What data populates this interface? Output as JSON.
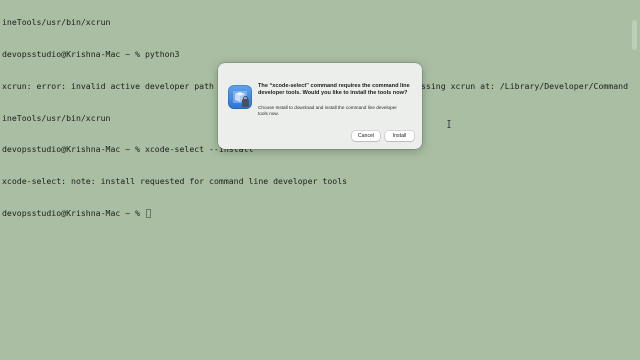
{
  "terminal": {
    "lines": [
      "ineTools/usr/bin/xcrun",
      "devopsstudio@Krishna-Mac ~ % python3",
      "xcrun: error: invalid active developer path (/Library/Developer/CommandLineTools), missing xcrun at: /Library/Developer/CommandL",
      "ineTools/usr/bin/xcrun",
      "devopsstudio@Krishna-Mac ~ % xcode-select --install",
      "xcode-select: note: install requested for command line developer tools",
      "devopsstudio@Krishna-Mac ~ % "
    ]
  },
  "dialog": {
    "title": "The “xcode-select” command requires the command line developer tools. Would you like to install the tools now?",
    "message": "Choose Install to download and install the command line developer tools now.",
    "cancel_label": "Cancel",
    "install_label": "Install",
    "icon": "installer-app-icon"
  },
  "colors": {
    "background": "#a9bea3",
    "text": "#1e1e1e",
    "dialog": "#eceeec"
  }
}
